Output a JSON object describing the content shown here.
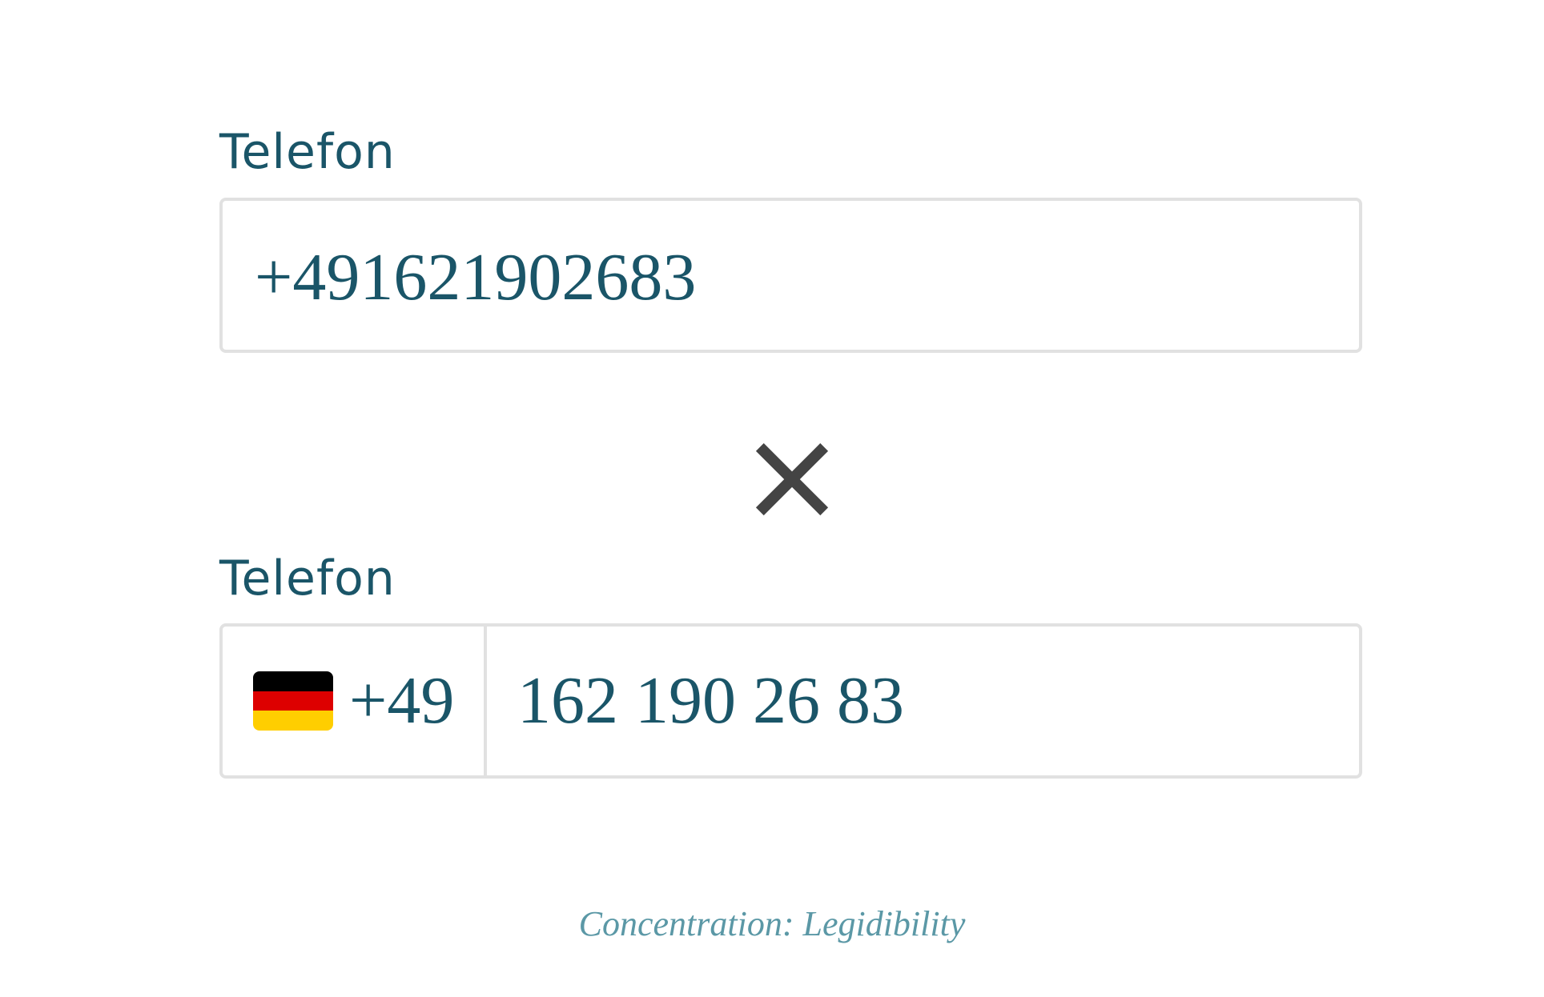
{
  "form_bad": {
    "label": "Telefon",
    "value": "+491621902683"
  },
  "divider": {
    "icon": "close-icon",
    "color": "#444444"
  },
  "form_good": {
    "label": "Telefon",
    "country_flag": "germany-flag-icon",
    "country_code": "+49",
    "value": "162 190 26 83"
  },
  "caption": "Concentration: Legidibility",
  "colors": {
    "text": "#1a5568",
    "border": "#e1e1e1",
    "caption": "#5b98a6"
  }
}
